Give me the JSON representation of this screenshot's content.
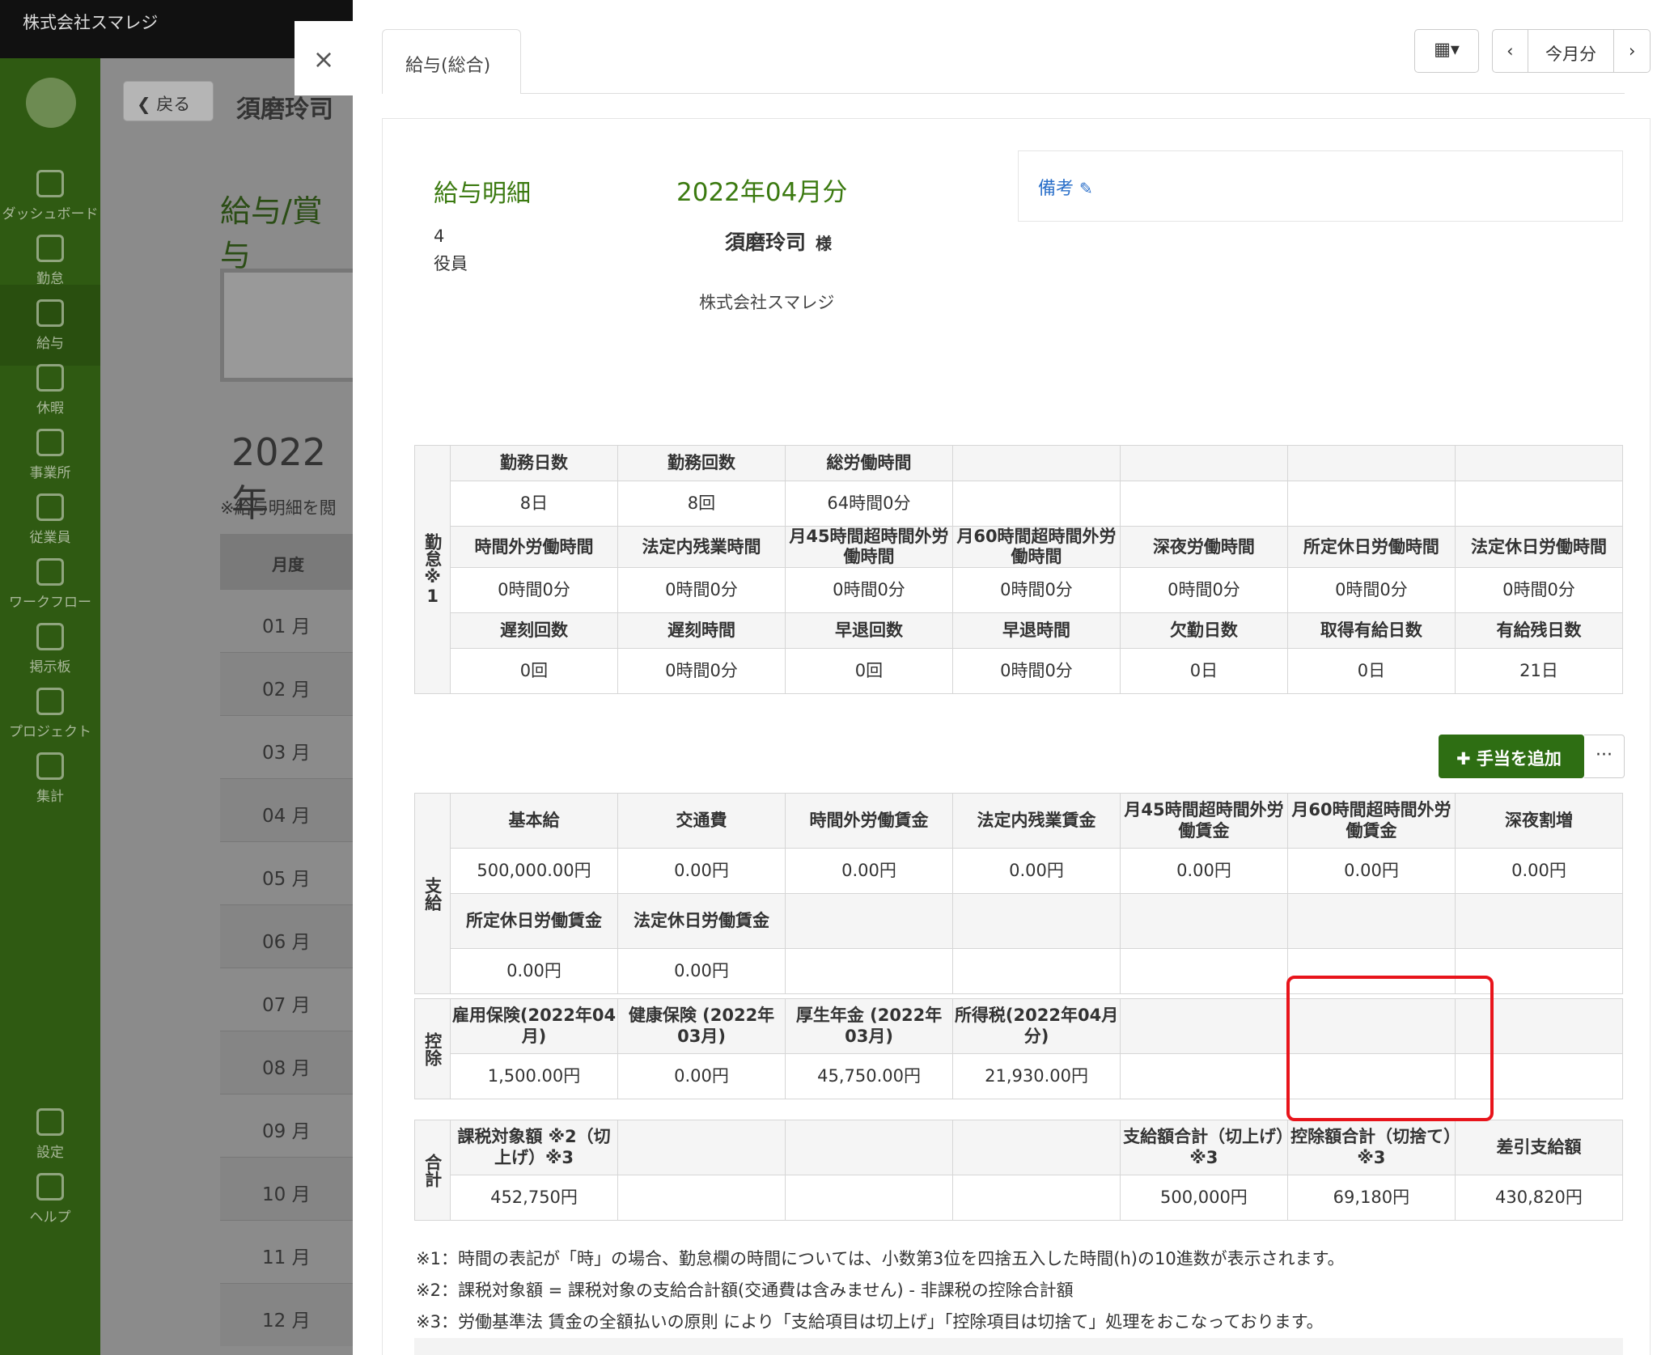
{
  "app": {
    "company_title": "株式会社スマレジ",
    "back_label": "戻る",
    "employee_name": "須磨玲司",
    "page_title": "給与/賞与",
    "year_title": "2022年",
    "note_partial": "※給与明細を閲",
    "col_month": "月度",
    "months": [
      "01 月",
      "02 月",
      "03 月",
      "04 月",
      "05 月",
      "06 月",
      "07 月",
      "08 月",
      "09 月",
      "10 月",
      "11 月",
      "12 月"
    ],
    "sidebar": [
      {
        "label": "ダッシュボード",
        "icon": "dashboard-icon"
      },
      {
        "label": "勤怠",
        "icon": "clock-icon"
      },
      {
        "label": "給与",
        "icon": "calculator-icon"
      },
      {
        "label": "休暇",
        "icon": "umbrella-icon"
      },
      {
        "label": "事業所",
        "icon": "home-icon"
      },
      {
        "label": "従業員",
        "icon": "user-icon"
      },
      {
        "label": "ワークフロー",
        "icon": "workflow-icon"
      },
      {
        "label": "掲示板",
        "icon": "board-icon"
      },
      {
        "label": "プロジェクト",
        "icon": "flag-icon"
      },
      {
        "label": "集計",
        "icon": "chart-icon"
      },
      {
        "label": "設定",
        "icon": "gear-icon"
      },
      {
        "label": "ヘルプ",
        "icon": "help-icon"
      }
    ]
  },
  "modal": {
    "close": "×",
    "tab": "給与(総合)",
    "calendar": "▦▾",
    "prev": "‹",
    "this_month": "今月分",
    "next": "›",
    "slip_title": "給与明細",
    "period": "2022年04月分",
    "remarks": "備考",
    "employee_no": "4",
    "role": "役員",
    "name": "須磨玲司",
    "honorific": "様",
    "company": "株式会社スマレジ",
    "add_allowance": "手当を追加",
    "more": "···"
  },
  "kintai": {
    "side": "勤怠※1",
    "rows": [
      {
        "h": [
          "勤務日数",
          "勤務回数",
          "総労働時間",
          "",
          "",
          "",
          ""
        ],
        "v": [
          "8日",
          "8回",
          "64時間0分",
          "",
          "",
          "",
          ""
        ]
      },
      {
        "h": [
          "時間外労働時間",
          "法定内残業時間",
          "月45時間超時間外労働時間",
          "月60時間超時間外労働時間",
          "深夜労働時間",
          "所定休日労働時間",
          "法定休日労働時間"
        ],
        "v": [
          "0時間0分",
          "0時間0分",
          "0時間0分",
          "0時間0分",
          "0時間0分",
          "0時間0分",
          "0時間0分"
        ]
      },
      {
        "h": [
          "遅刻回数",
          "遅刻時間",
          "早退回数",
          "早退時間",
          "欠勤日数",
          "取得有給日数",
          "有給残日数"
        ],
        "v": [
          "0回",
          "0時間0分",
          "0回",
          "0時間0分",
          "0日",
          "0日",
          "21日"
        ]
      }
    ]
  },
  "shikyu": {
    "side": "支給",
    "rows": [
      {
        "h": [
          "基本給",
          "交通費",
          "時間外労働賃金",
          "法定内残業賃金",
          "月45時間超時間外労働賃金",
          "月60時間超時間外労働賃金",
          "深夜割増"
        ],
        "v": [
          "500,000.00円",
          "0.00円",
          "0.00円",
          "0.00円",
          "0.00円",
          "0.00円",
          "0.00円"
        ]
      },
      {
        "h": [
          "所定休日労働賃金",
          "法定休日労働賃金",
          "",
          "",
          "",
          "",
          ""
        ],
        "v": [
          "0.00円",
          "0.00円",
          "",
          "",
          "",
          "",
          ""
        ]
      }
    ]
  },
  "koujo": {
    "side": "控除",
    "rows": [
      {
        "h": [
          "雇用保険(2022年04月)",
          "健康保険 (2022年03月)",
          "厚生年金 (2022年03月)",
          "所得税(2022年04月分)",
          "",
          "",
          ""
        ],
        "v": [
          "1,500.00円",
          "0.00円",
          "45,750.00円",
          "21,930.00円",
          "",
          "",
          ""
        ]
      }
    ]
  },
  "goukei": {
    "side": "合計",
    "rows": [
      {
        "h": [
          "課税対象額 ※2（切上げ）※3",
          "",
          "",
          "",
          "支給額合計（切上げ）※3",
          "控除額合計（切捨て）※3",
          "差引支給額"
        ],
        "v": [
          "452,750円",
          "",
          "",
          "",
          "500,000円",
          "69,180円",
          "430,820円"
        ]
      }
    ]
  },
  "notes": [
    "※1：時間の表記が「時」の場合、勤怠欄の時間については、小数第3位を四捨五入した時間(h)の10進数が表示されます。",
    "※2：課税対象額 = 課税対象の支給合計額(交通費は含みません) - 非課税の控除合計額",
    "※3：労働基準法 賃金の全額払いの原則 により「支給項目は切上げ」「控除項目は切捨て」処理をおこなっております。"
  ]
}
